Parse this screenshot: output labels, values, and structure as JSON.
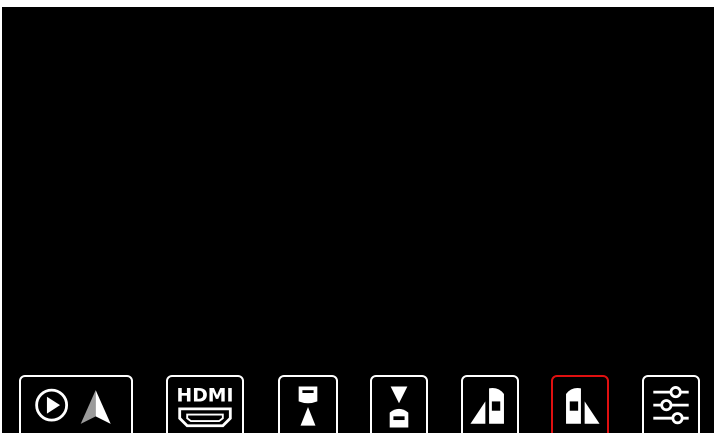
{
  "screen": {
    "background": "#000000",
    "selected_color": "#e01010",
    "icon_color": "#ffffff"
  },
  "toolbar": {
    "buttons": [
      {
        "icon": "carplay-android-auto-icon",
        "selected": false
      },
      {
        "icon": "hdmi-icon",
        "label": "HDMI",
        "selected": false
      },
      {
        "icon": "front-camera-icon",
        "selected": false
      },
      {
        "icon": "rear-camera-icon",
        "selected": false
      },
      {
        "icon": "left-camera-icon",
        "selected": false
      },
      {
        "icon": "right-camera-icon",
        "selected": true
      },
      {
        "icon": "settings-sliders-icon",
        "selected": false
      }
    ]
  }
}
